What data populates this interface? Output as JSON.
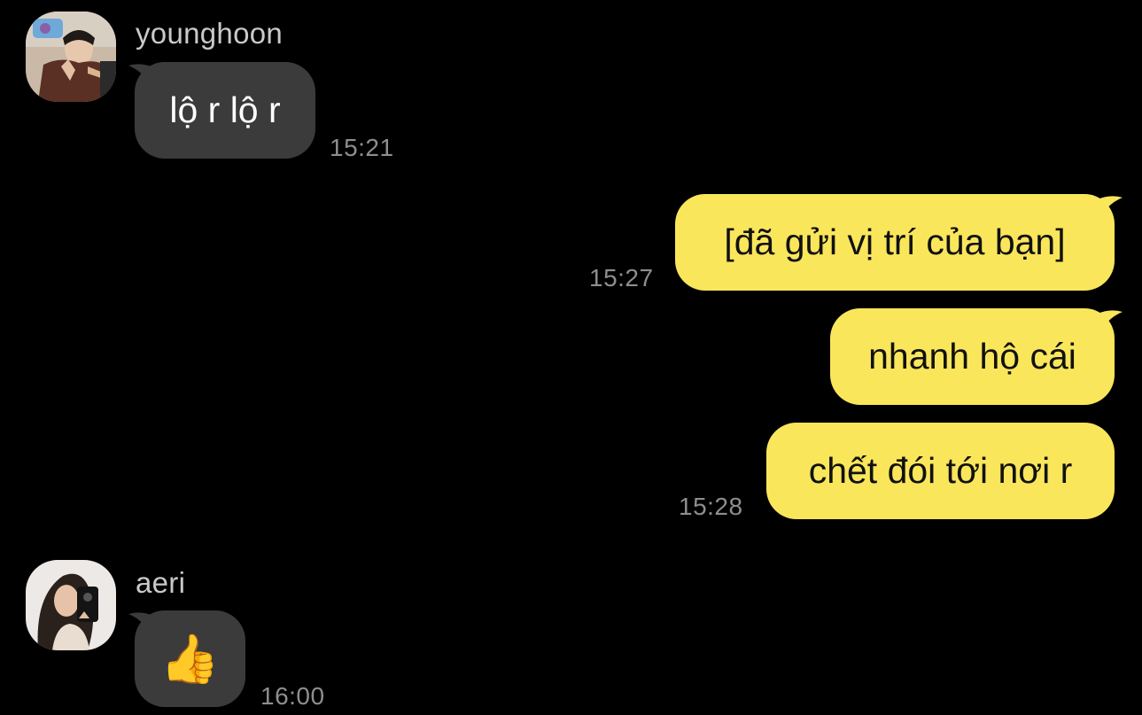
{
  "messages": [
    {
      "sender": "younghoon",
      "text": "lộ r lộ r",
      "time": "15:21"
    },
    {
      "text": "[đã gửi vị trí của bạn]",
      "time": "15:27"
    },
    {
      "text": "nhanh hộ cái"
    },
    {
      "text": "chết đói tới nơi r",
      "time": "15:28"
    },
    {
      "sender": "aeri",
      "text": "👍",
      "time": "16:00"
    }
  ],
  "colors": {
    "background": "#000000",
    "incoming_bubble": "#3b3b3b",
    "outgoing_bubble": "#fae65b",
    "timestamp": "#8e8e8e"
  }
}
